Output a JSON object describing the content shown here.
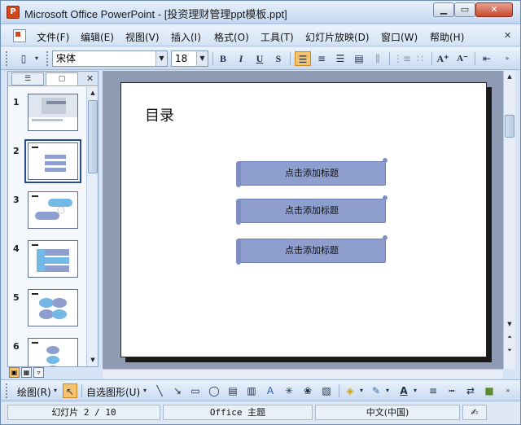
{
  "window": {
    "title": "Microsoft Office PowerPoint - [投资理财管理ppt模板.ppt]",
    "min_glyph": "▁",
    "max_glyph": "▭",
    "close_glyph": "✕"
  },
  "menu": {
    "items": [
      "文件(F)",
      "编辑(E)",
      "视图(V)",
      "插入(I)",
      "格式(O)",
      "工具(T)",
      "幻灯片放映(D)",
      "窗口(W)",
      "帮助(H)"
    ],
    "close_glyph": "✕"
  },
  "toolbar": {
    "font_name": "宋体",
    "font_size": "18",
    "bold": "B",
    "italic": "I",
    "underline": "U",
    "shadow": "S"
  },
  "left_pane": {
    "slides": [
      {
        "number": "1"
      },
      {
        "number": "2",
        "selected": true
      },
      {
        "number": "3"
      },
      {
        "number": "4"
      },
      {
        "number": "5"
      },
      {
        "number": "6"
      }
    ],
    "close_glyph": "✕"
  },
  "slide": {
    "title": "目录",
    "boxes": [
      "点击添加标题",
      "点击添加标题",
      "点击添加标题"
    ]
  },
  "drawing": {
    "draw_label": "绘图(R)",
    "autoshapes_label": "自选图形(U)"
  },
  "status": {
    "slide_info": "幻灯片 2 / 10",
    "theme": "Office 主题",
    "language": "中文(中国)"
  },
  "colors": {
    "accent_box": "#8e9ecf",
    "editor_bg": "#8e9bb3",
    "active_tool": "#f6c26b"
  }
}
